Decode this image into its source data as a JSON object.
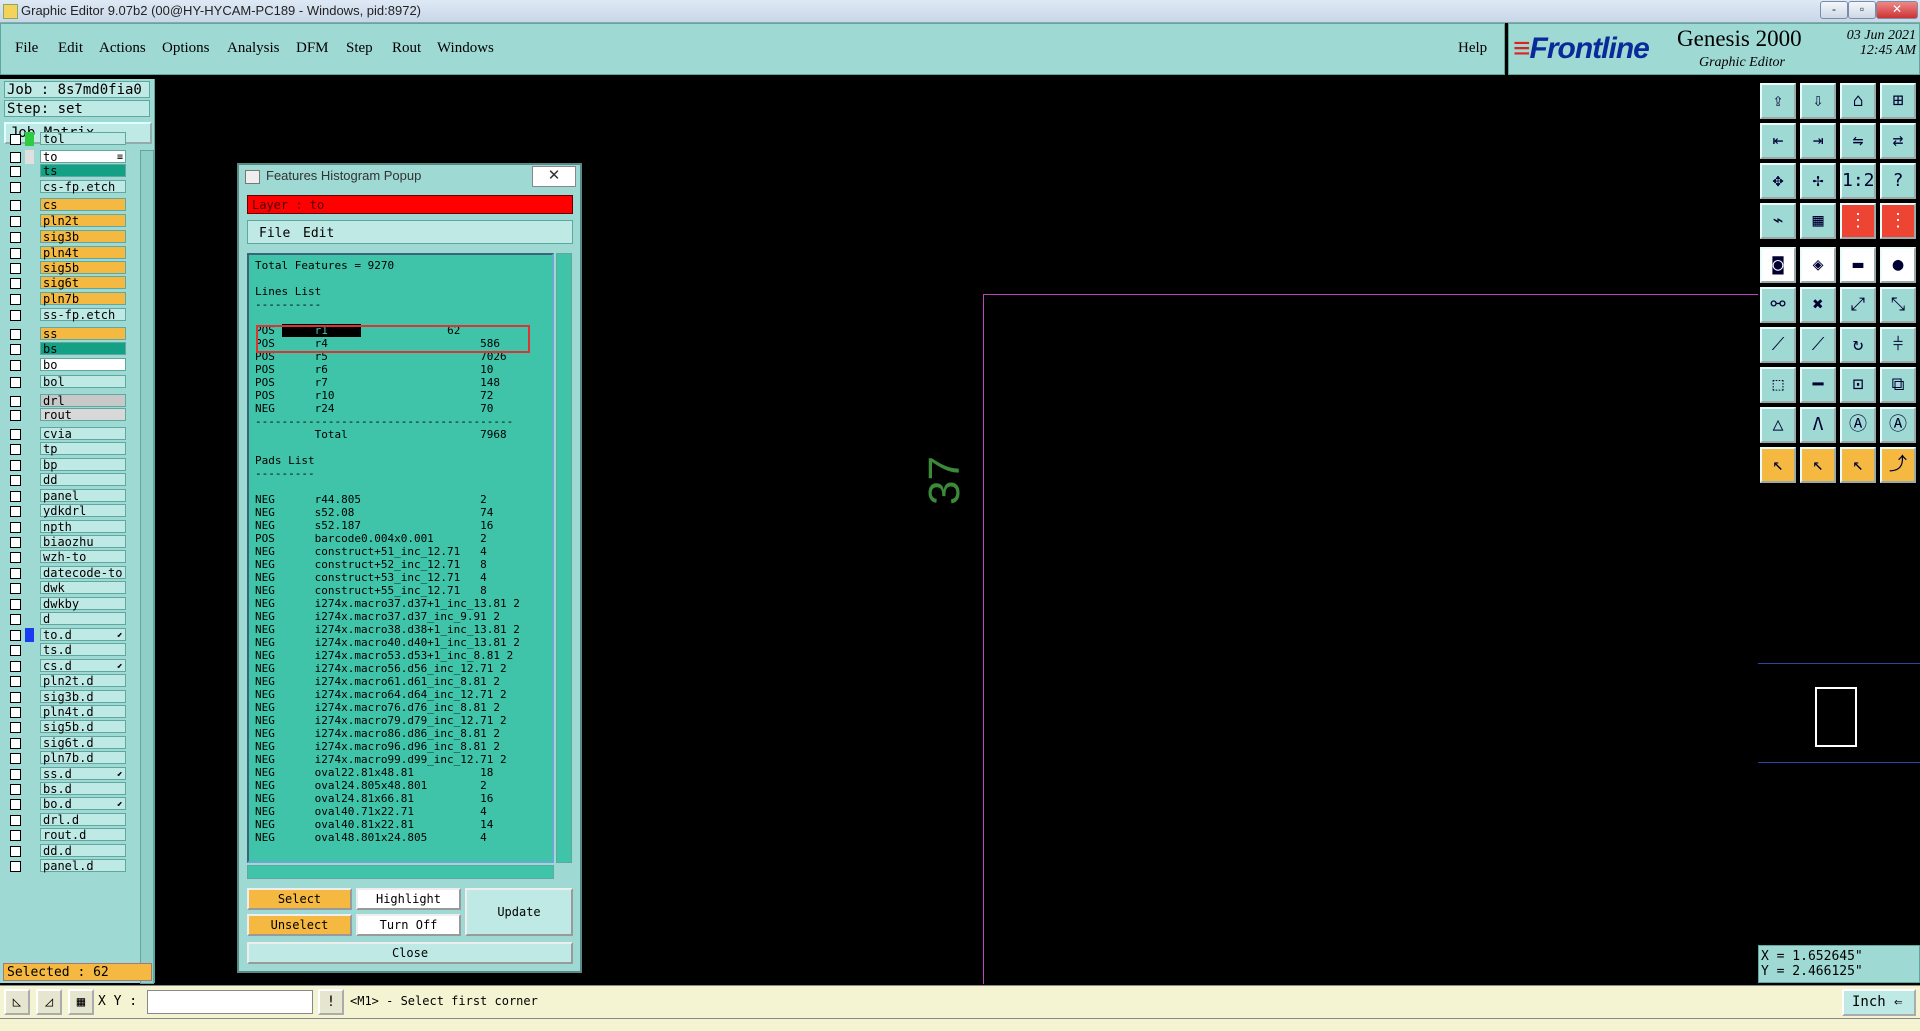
{
  "window": {
    "title": "Graphic Editor 9.07b2 (00@HY-HYCAM-PC189 - Windows, pid:8972)",
    "controls": [
      "-",
      "▫",
      "✕"
    ]
  },
  "menubar": {
    "items": [
      "File",
      "Edit",
      "Actions",
      "Options",
      "Analysis",
      "DFM",
      "Step",
      "Rout",
      "Windows"
    ],
    "help": "Help"
  },
  "logo": {
    "brand": "Frontline",
    "product": "Genesis 2000",
    "subtitle": "Graphic Editor",
    "date": "03 Jun 2021",
    "time": "12:45 AM"
  },
  "left_panel": {
    "job": "Job : 8s7md0fia0",
    "step": "Step: set",
    "job_matrix": "Job Matrix ...",
    "selected": "Selected : 62",
    "layers": [
      {
        "name": "tol",
        "color": "#bfe9e4",
        "swatch": "#2ecc40",
        "mark": ""
      },
      {
        "name": "to",
        "color": "#ffffff",
        "swatch": "#e0e0e0",
        "mark": "≡",
        "active": true
      },
      {
        "name": "ts",
        "color": "#13a085",
        "swatch": "",
        "mark": ""
      },
      {
        "name": "cs-fp.etch",
        "color": "#bfe9e4",
        "swatch": "",
        "mark": ""
      },
      {
        "name": "cs",
        "color": "#f5b942",
        "swatch": "",
        "mark": ""
      },
      {
        "name": "pln2t",
        "color": "#f5b942",
        "swatch": "",
        "mark": ""
      },
      {
        "name": "sig3b",
        "color": "#f5b942",
        "swatch": "",
        "mark": ""
      },
      {
        "name": "pln4t",
        "color": "#f5b942",
        "swatch": "",
        "mark": ""
      },
      {
        "name": "sig5b",
        "color": "#f5b942",
        "swatch": "",
        "mark": ""
      },
      {
        "name": "sig6t",
        "color": "#f5b942",
        "swatch": "",
        "mark": ""
      },
      {
        "name": "pln7b",
        "color": "#f5b942",
        "swatch": "",
        "mark": ""
      },
      {
        "name": "ss-fp.etch",
        "color": "#bfe9e4",
        "swatch": "",
        "mark": ""
      },
      {
        "name": "ss",
        "color": "#f5b942",
        "swatch": "",
        "mark": ""
      },
      {
        "name": "bs",
        "color": "#13a085",
        "swatch": "",
        "mark": ""
      },
      {
        "name": "bo",
        "color": "#ffffff",
        "swatch": "",
        "mark": ""
      },
      {
        "name": "bol",
        "color": "#bfe9e4",
        "swatch": "",
        "mark": ""
      },
      {
        "name": "drl",
        "color": "#c8c8c8",
        "swatch": "",
        "mark": ""
      },
      {
        "name": "rout",
        "color": "#d8d8d8",
        "swatch": "",
        "mark": ""
      },
      {
        "name": "cvia",
        "color": "#bfe9e4",
        "swatch": "",
        "mark": ""
      },
      {
        "name": "tp",
        "color": "#bfe9e4",
        "swatch": "",
        "mark": ""
      },
      {
        "name": "bp",
        "color": "#bfe9e4",
        "swatch": "",
        "mark": ""
      },
      {
        "name": "dd",
        "color": "#bfe9e4",
        "swatch": "",
        "mark": ""
      },
      {
        "name": "panel",
        "color": "#bfe9e4",
        "swatch": "",
        "mark": ""
      },
      {
        "name": "ydkdrl",
        "color": "#bfe9e4",
        "swatch": "",
        "mark": ""
      },
      {
        "name": "npth",
        "color": "#bfe9e4",
        "swatch": "",
        "mark": ""
      },
      {
        "name": "biaozhu",
        "color": "#bfe9e4",
        "swatch": "",
        "mark": ""
      },
      {
        "name": "wzh-to",
        "color": "#bfe9e4",
        "swatch": "",
        "mark": ""
      },
      {
        "name": "datecode-to",
        "color": "#bfe9e4",
        "swatch": "",
        "mark": ""
      },
      {
        "name": "dwk",
        "color": "#bfe9e4",
        "swatch": "",
        "mark": ""
      },
      {
        "name": "dwkby",
        "color": "#bfe9e4",
        "swatch": "",
        "mark": ""
      },
      {
        "name": "d",
        "color": "#bfe9e4",
        "swatch": "",
        "mark": ""
      },
      {
        "name": "to.d",
        "color": "#bfe9e4",
        "swatch": "#1a3cf0",
        "mark": "⬋"
      },
      {
        "name": "ts.d",
        "color": "#bfe9e4",
        "swatch": "",
        "mark": ""
      },
      {
        "name": "cs.d",
        "color": "#bfe9e4",
        "swatch": "",
        "mark": "⬋"
      },
      {
        "name": "pln2t.d",
        "color": "#bfe9e4",
        "swatch": "",
        "mark": ""
      },
      {
        "name": "sig3b.d",
        "color": "#bfe9e4",
        "swatch": "",
        "mark": ""
      },
      {
        "name": "pln4t.d",
        "color": "#bfe9e4",
        "swatch": "",
        "mark": ""
      },
      {
        "name": "sig5b.d",
        "color": "#bfe9e4",
        "swatch": "",
        "mark": ""
      },
      {
        "name": "sig6t.d",
        "color": "#bfe9e4",
        "swatch": "",
        "mark": ""
      },
      {
        "name": "pln7b.d",
        "color": "#bfe9e4",
        "swatch": "",
        "mark": ""
      },
      {
        "name": "ss.d",
        "color": "#bfe9e4",
        "swatch": "",
        "mark": "⬋"
      },
      {
        "name": "bs.d",
        "color": "#bfe9e4",
        "swatch": "",
        "mark": ""
      },
      {
        "name": "bo.d",
        "color": "#bfe9e4",
        "swatch": "",
        "mark": "⬋"
      },
      {
        "name": "drl.d",
        "color": "#bfe9e4",
        "swatch": "",
        "mark": ""
      },
      {
        "name": "rout.d",
        "color": "#bfe9e4",
        "swatch": "",
        "mark": ""
      },
      {
        "name": "dd.d",
        "color": "#bfe9e4",
        "swatch": "",
        "mark": ""
      },
      {
        "name": "panel.d",
        "color": "#bfe9e4",
        "swatch": "",
        "mark": ""
      }
    ]
  },
  "canvas": {
    "label": "37",
    "profile_color": "#c040c0"
  },
  "popup": {
    "title": "Features Histogram Popup",
    "close": "✕",
    "layer_label": "Layer :  to",
    "menu": [
      "File",
      "Edit"
    ],
    "total": "Total Features = 9270",
    "lines_header": "Lines List",
    "lines": [
      {
        "pol": "POS",
        "sym": "r1",
        "count": "62"
      },
      {
        "pol": "POS",
        "sym": "r4",
        "count": "586"
      },
      {
        "pol": "POS",
        "sym": "r5",
        "count": "7026"
      },
      {
        "pol": "POS",
        "sym": "r6",
        "count": "10"
      },
      {
        "pol": "POS",
        "sym": "r7",
        "count": "148"
      },
      {
        "pol": "POS",
        "sym": "r10",
        "count": "72"
      },
      {
        "pol": "NEG",
        "sym": "r24",
        "count": "70"
      }
    ],
    "lines_total_label": "Total",
    "lines_total": "7968",
    "pads_header": "Pads List",
    "pads": [
      {
        "pol": "NEG",
        "sym": "r44.805",
        "count": "2"
      },
      {
        "pol": "NEG",
        "sym": "s52.08",
        "count": "74"
      },
      {
        "pol": "NEG",
        "sym": "s52.187",
        "count": "16"
      },
      {
        "pol": "POS",
        "sym": "barcode0.004x0.001",
        "count": "2"
      },
      {
        "pol": "NEG",
        "sym": "construct+51_inc_12.71",
        "count": "4"
      },
      {
        "pol": "NEG",
        "sym": "construct+52_inc_12.71",
        "count": "8"
      },
      {
        "pol": "NEG",
        "sym": "construct+53_inc_12.71",
        "count": "4"
      },
      {
        "pol": "NEG",
        "sym": "construct+55_inc_12.71",
        "count": "8"
      },
      {
        "pol": "NEG",
        "sym": "i274x.macro37.d37+1_inc_13.81",
        "count": "2"
      },
      {
        "pol": "NEG",
        "sym": "i274x.macro37.d37_inc_9.91",
        "count": "2"
      },
      {
        "pol": "NEG",
        "sym": "i274x.macro38.d38+1_inc_13.81",
        "count": "2"
      },
      {
        "pol": "NEG",
        "sym": "i274x.macro40.d40+1_inc_13.81",
        "count": "2"
      },
      {
        "pol": "NEG",
        "sym": "i274x.macro53.d53+1_inc_8.81",
        "count": "2"
      },
      {
        "pol": "NEG",
        "sym": "i274x.macro56.d56_inc_12.71",
        "count": "2"
      },
      {
        "pol": "NEG",
        "sym": "i274x.macro61.d61_inc_8.81",
        "count": "2"
      },
      {
        "pol": "NEG",
        "sym": "i274x.macro64.d64_inc_12.71",
        "count": "2"
      },
      {
        "pol": "NEG",
        "sym": "i274x.macro76.d76_inc_8.81",
        "count": "2"
      },
      {
        "pol": "NEG",
        "sym": "i274x.macro79.d79_inc_12.71",
        "count": "2"
      },
      {
        "pol": "NEG",
        "sym": "i274x.macro86.d86_inc_8.81",
        "count": "2"
      },
      {
        "pol": "NEG",
        "sym": "i274x.macro96.d96_inc_8.81",
        "count": "2"
      },
      {
        "pol": "NEG",
        "sym": "i274x.macro99.d99_inc_12.71",
        "count": "2"
      },
      {
        "pol": "NEG",
        "sym": "oval22.81x48.81",
        "count": "18"
      },
      {
        "pol": "NEG",
        "sym": "oval24.805x48.801",
        "count": "2"
      },
      {
        "pol": "NEG",
        "sym": "oval24.81x66.81",
        "count": "16"
      },
      {
        "pol": "NEG",
        "sym": "oval40.71x22.71",
        "count": "4"
      },
      {
        "pol": "NEG",
        "sym": "oval40.81x22.81",
        "count": "14"
      },
      {
        "pol": "NEG",
        "sym": "oval48.801x24.805",
        "count": "4"
      }
    ],
    "buttons": {
      "select": "Select",
      "highlight": "Highlight",
      "update": "Update",
      "unselect": "Unselect",
      "turn_off": "Turn Off",
      "close": "Close"
    }
  },
  "right_panel": {
    "coord_x": "X = 1.652645\"",
    "coord_y": "Y = 2.466125\""
  },
  "statusbar": {
    "xy_label": "X Y :",
    "xy_value": "",
    "prompt": "<M1> - Select first corner",
    "unit": "Inch ⇐"
  }
}
